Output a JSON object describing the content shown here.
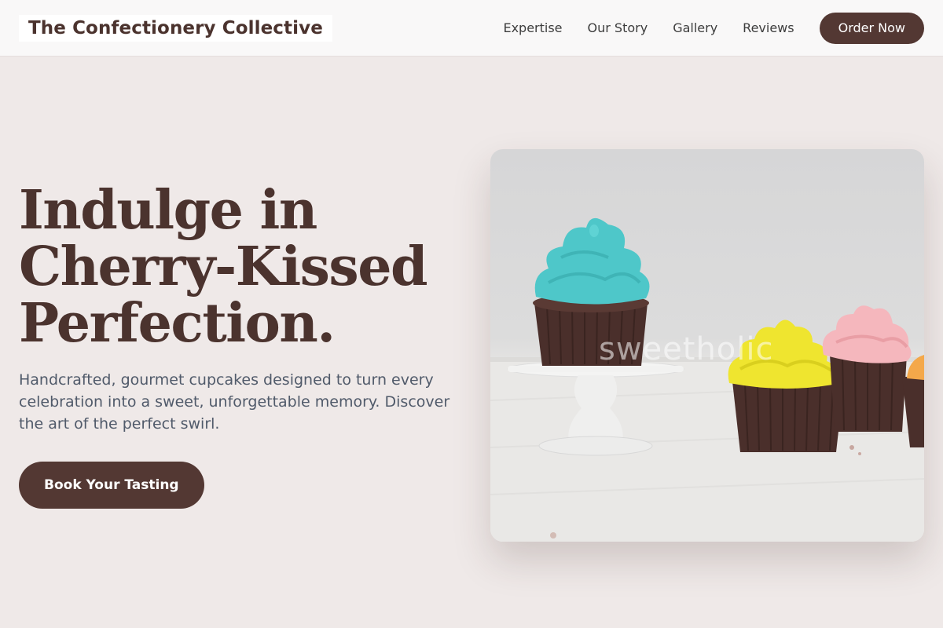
{
  "header": {
    "brand": "The Confectionery Collective",
    "nav": [
      "Expertise",
      "Our Story",
      "Gallery",
      "Reviews"
    ],
    "order_label": "Order Now"
  },
  "hero": {
    "title_lines": [
      "Indulge in",
      "Cherry-Kissed",
      "Perfection."
    ],
    "subtitle": "Handcrafted, gourmet cupcakes designed to turn every celebration into a sweet, unforgettable memory. Discover the art of the perfect swirl.",
    "cta_label": "Book Your Tasting"
  },
  "image": {
    "watermark": "sweetholic"
  },
  "colors": {
    "brand": "#533833",
    "background": "#efe9e8",
    "text_dark": "#4b332e",
    "text_muted": "#505a6a"
  }
}
